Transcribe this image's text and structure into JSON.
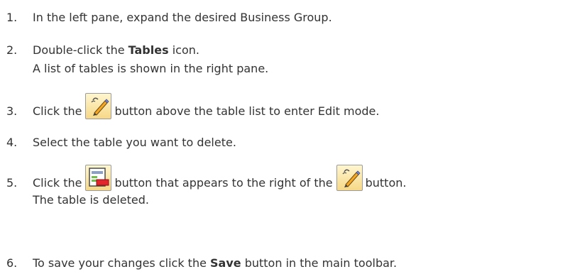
{
  "steps": [
    {
      "number": "1.",
      "text": "In the left pane, expand the desired Business Group."
    },
    {
      "number": "2.",
      "pre": "Double-click the ",
      "bold": "Tables",
      "post": " icon.",
      "result": "A list of tables is shown in the right pane."
    },
    {
      "number": "3.",
      "pre": "Click the",
      "post": "button above the table list to enter Edit mode.",
      "icon": "edit-mode-icon"
    },
    {
      "number": "4.",
      "text": "Select the table you want to delete."
    },
    {
      "number": "5.",
      "pre": "Click the",
      "mid": "button that appears to the right of the",
      "post": "button.",
      "result": "The table is deleted.",
      "icons": [
        "delete-table-icon",
        "edit-mode-icon"
      ]
    },
    {
      "number": "6.",
      "pre": "To save your changes click the ",
      "bold": "Save",
      "post": " button in the main toolbar."
    }
  ],
  "colors": {
    "text": "#333333",
    "icon_background": "#f6d887",
    "icon_border": "#9b9b9b",
    "delete_red": "#e3262b",
    "panel_green": "#6fbf4a"
  }
}
